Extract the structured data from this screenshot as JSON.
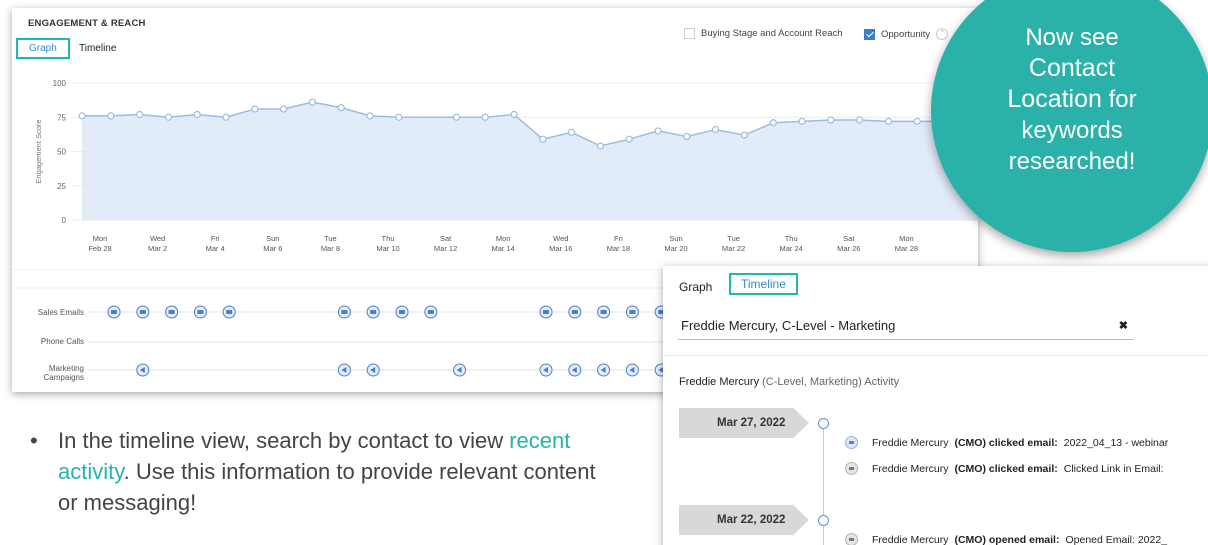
{
  "engagement_panel": {
    "title": "ENGAGEMENT & REACH",
    "tabs": [
      "Graph",
      "Timeline"
    ],
    "options": [
      {
        "label": "Buying Stage and Account Reach",
        "checked": false
      },
      {
        "label": "Opportunity",
        "checked": true
      }
    ],
    "row_labels": [
      "Sales Emails",
      "Phone Calls",
      "Marketing",
      "Campaigns"
    ],
    "icon_color": "#4a7fc9"
  },
  "chart_data": {
    "type": "area",
    "ylabel": "Engagement Score",
    "ylim": [
      0,
      100
    ],
    "yticks": [
      0,
      25,
      50,
      75,
      100
    ],
    "tick_labels": [
      [
        "Mon",
        "Feb 28"
      ],
      [
        "Wed",
        "Mar 2"
      ],
      [
        "Fri",
        "Mar 4"
      ],
      [
        "Sun",
        "Mar 6"
      ],
      [
        "Tue",
        "Mar 8"
      ],
      [
        "Thu",
        "Mar 10"
      ],
      [
        "Sat",
        "Mar 12"
      ],
      [
        "Mon",
        "Mar 14"
      ],
      [
        "Wed",
        "Mar 16"
      ],
      [
        "Fri",
        "Mar 18"
      ],
      [
        "Sun",
        "Mar 20"
      ],
      [
        "Tue",
        "Mar 22"
      ],
      [
        "Thu",
        "Mar 24"
      ],
      [
        "Sat",
        "Mar 26"
      ],
      [
        "Mon",
        "Mar 28"
      ]
    ],
    "x": [
      0,
      1,
      2,
      3,
      4,
      5,
      6,
      7,
      8,
      9,
      10,
      11,
      13,
      14,
      15,
      16,
      17,
      18,
      19,
      20,
      21,
      22,
      23,
      24,
      25,
      26,
      27,
      28,
      29,
      30
    ],
    "values": [
      76,
      76,
      77,
      75,
      77,
      75,
      81,
      81,
      86,
      82,
      76,
      75,
      75,
      75,
      77,
      59,
      64,
      54,
      59,
      65,
      61,
      66,
      62,
      71,
      72,
      73,
      73,
      72,
      72,
      72
    ],
    "line_color": "#9bbbe6",
    "fill_color": "#dde8f7",
    "grid": true,
    "activity_days": {
      "sales_emails": [
        0,
        1,
        2,
        3,
        4,
        8,
        9,
        10,
        11,
        15,
        16,
        17,
        18,
        19
      ],
      "marketing_campaigns": [
        1,
        8,
        9,
        12,
        15,
        16,
        17,
        18,
        19
      ]
    }
  },
  "bullet": {
    "before": "In the timeline  view, search by contact to view ",
    "link": "recent activity",
    "after": ". Use this information to provide relevant content or messaging!"
  },
  "callout": {
    "line1": "Now see",
    "line2": "Contact",
    "line3": "Location",
    "line3b": " for",
    "line4": "keywords",
    "line5": "researched!",
    "color": "#2ab1aa"
  },
  "timeline_panel": {
    "tabs": [
      "Graph",
      "Timeline"
    ],
    "search_value": "Freddie Mercury, C-Level - Marketing",
    "clear_symbol": "✖",
    "activity_name": "Freddie Mercury",
    "activity_sub": "(C-Level, Marketing) Activity",
    "groups": [
      {
        "date": "Mar 27, 2022",
        "events": [
          {
            "who": "Freddie Mercury",
            "role": "(CMO) clicked email:",
            "desc": "2022_04_13 - webinar",
            "icon": "blue"
          },
          {
            "who": "Freddie Mercury",
            "role": "(CMO) clicked email:",
            "desc": "Clicked Link in Email:",
            "icon": "gray"
          }
        ]
      },
      {
        "date": "Mar 22, 2022",
        "events": [
          {
            "who": "Freddie Mercury",
            "role": "(CMO) opened email:",
            "desc": "Opened Email: 2022_",
            "icon": "gray"
          }
        ]
      }
    ]
  }
}
